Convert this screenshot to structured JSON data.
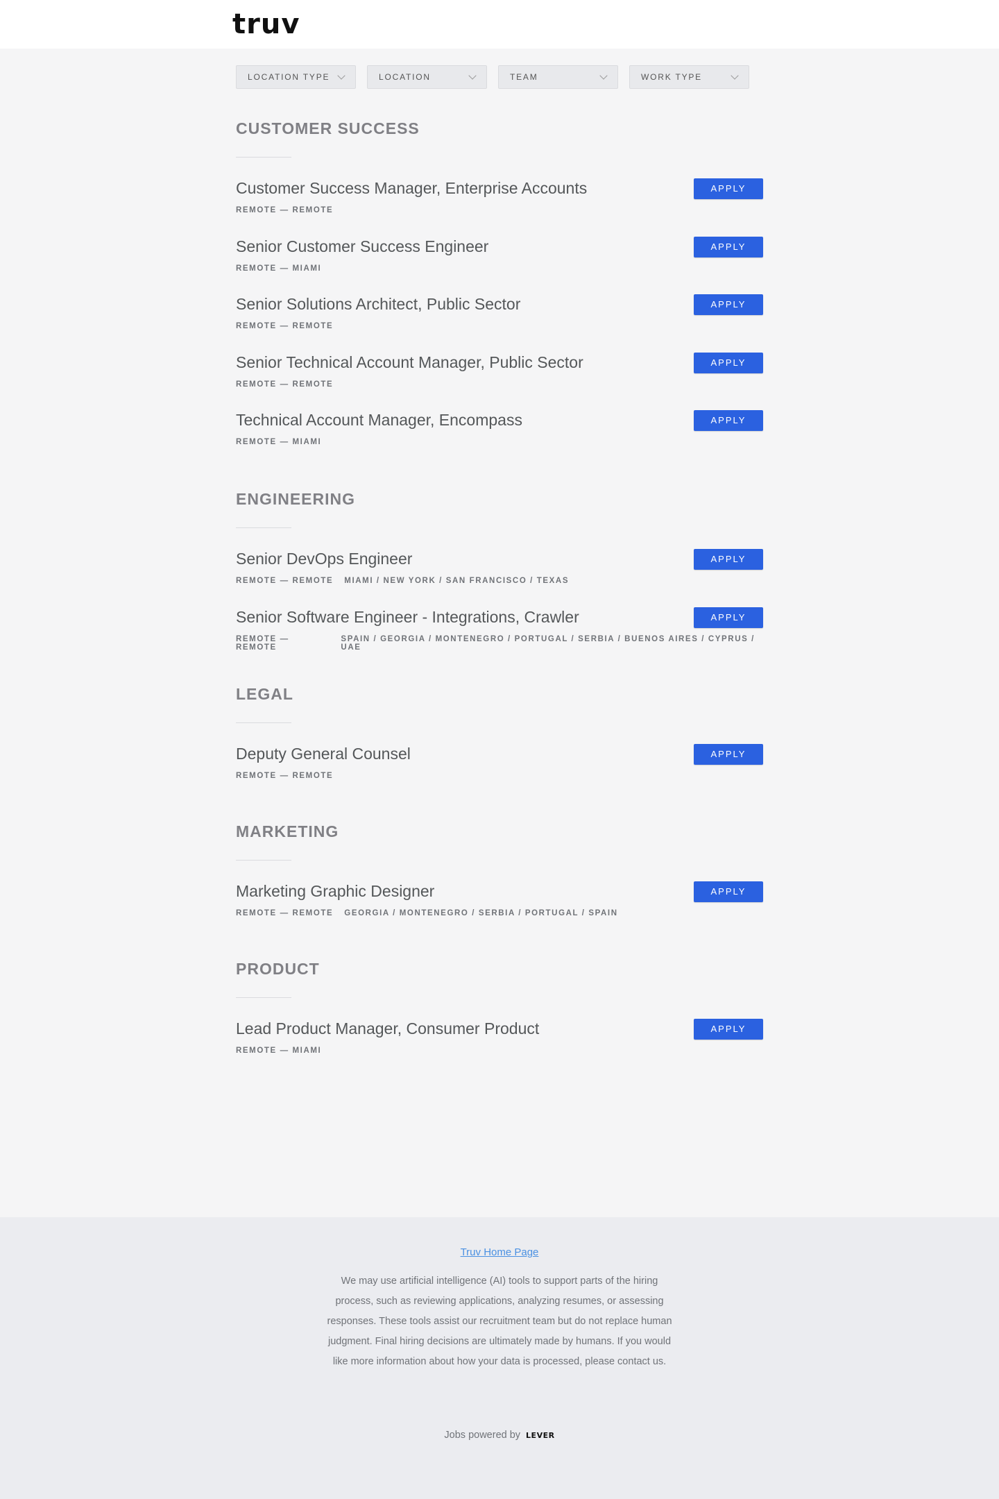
{
  "header": {
    "logo_text": "truv"
  },
  "filters": [
    {
      "label": "Location type"
    },
    {
      "label": "Location"
    },
    {
      "label": "Team"
    },
    {
      "label": "Work type"
    }
  ],
  "apply_label": "Apply",
  "sections": [
    {
      "title": "Customer Success",
      "postings": [
        {
          "title": "Customer Success Manager, Enterprise Accounts",
          "meta": "Remote — Remote",
          "locations": ""
        },
        {
          "title": "Senior Customer Success Engineer",
          "meta": "Remote — Miami",
          "locations": ""
        },
        {
          "title": "Senior Solutions Architect, Public Sector",
          "meta": "Remote — Remote",
          "locations": ""
        },
        {
          "title": "Senior Technical Account Manager, Public Sector",
          "meta": "Remote — Remote",
          "locations": ""
        },
        {
          "title": "Technical Account Manager, Encompass",
          "meta": "Remote — Miami",
          "locations": ""
        }
      ]
    },
    {
      "title": "Engineering",
      "postings": [
        {
          "title": "Senior DevOps Engineer",
          "meta": "Remote — Remote",
          "locations": "Miami / New York / San Francisco / Texas"
        },
        {
          "title": "Senior Software Engineer - Integrations, Crawler",
          "meta": "Remote — Remote",
          "locations": "Spain / Georgia / Montenegro / Portugal / Serbia / Buenos Aires / Cyprus / UAE"
        }
      ]
    },
    {
      "title": "Legal",
      "postings": [
        {
          "title": "Deputy General Counsel",
          "meta": "Remote — Remote",
          "locations": ""
        }
      ]
    },
    {
      "title": "Marketing",
      "postings": [
        {
          "title": "Marketing Graphic Designer",
          "meta": "Remote — Remote",
          "locations": "Georgia / Montenegro / Serbia / Portugal / Spain"
        }
      ]
    },
    {
      "title": "Product",
      "postings": [
        {
          "title": "Lead Product Manager, Consumer Product",
          "meta": "Remote — Miami",
          "locations": ""
        }
      ]
    }
  ],
  "footer": {
    "home_link": "Truv Home Page",
    "disclaimer": "We may use artificial intelligence (AI) tools to support parts of the hiring process, such as reviewing applications, analyzing resumes, or assessing responses. These tools assist our recruitment team but do not replace human judgment. Final hiring decisions are ultimately made by humans. If you would like more information about how your data is processed, please contact us.",
    "powered_by": "Jobs powered by",
    "powered_logo": "LEVER"
  },
  "colors": {
    "apply_button": "#2b61e0",
    "link": "#4a90e2",
    "page_bg": "#f5f5f6",
    "footer_bg": "#ebecf0"
  }
}
